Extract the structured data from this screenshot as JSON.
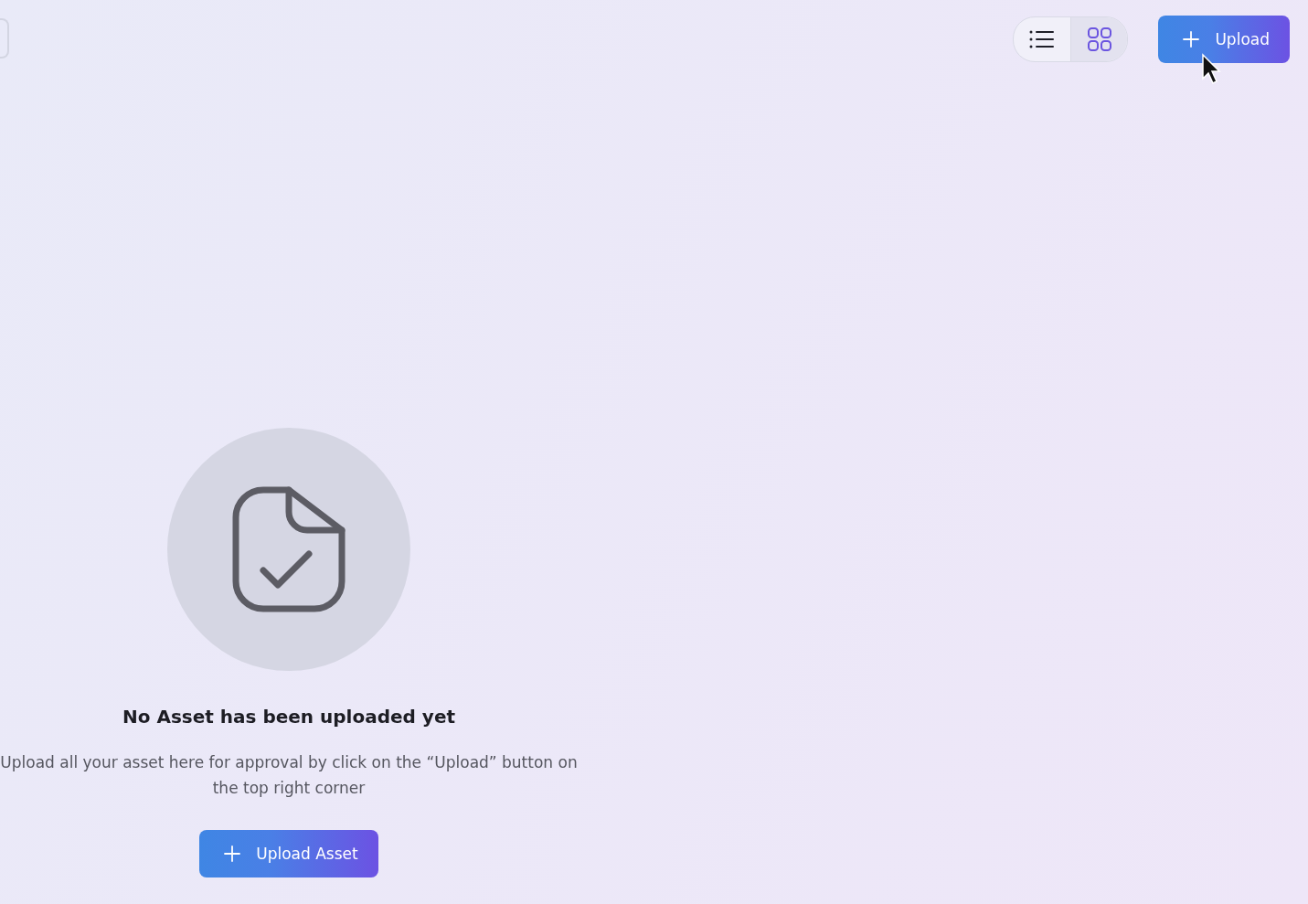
{
  "toolbar": {
    "view_modes": [
      {
        "kind": "list",
        "selected": false
      },
      {
        "kind": "grid",
        "selected": true
      }
    ],
    "upload_button": {
      "label": "Upload"
    }
  },
  "empty_state": {
    "title": "No Asset has been uploaded yet",
    "message": "Upload all your asset here for approval by click on the “Upload” button on the top right corner",
    "button": {
      "label": "Upload Asset"
    }
  }
}
